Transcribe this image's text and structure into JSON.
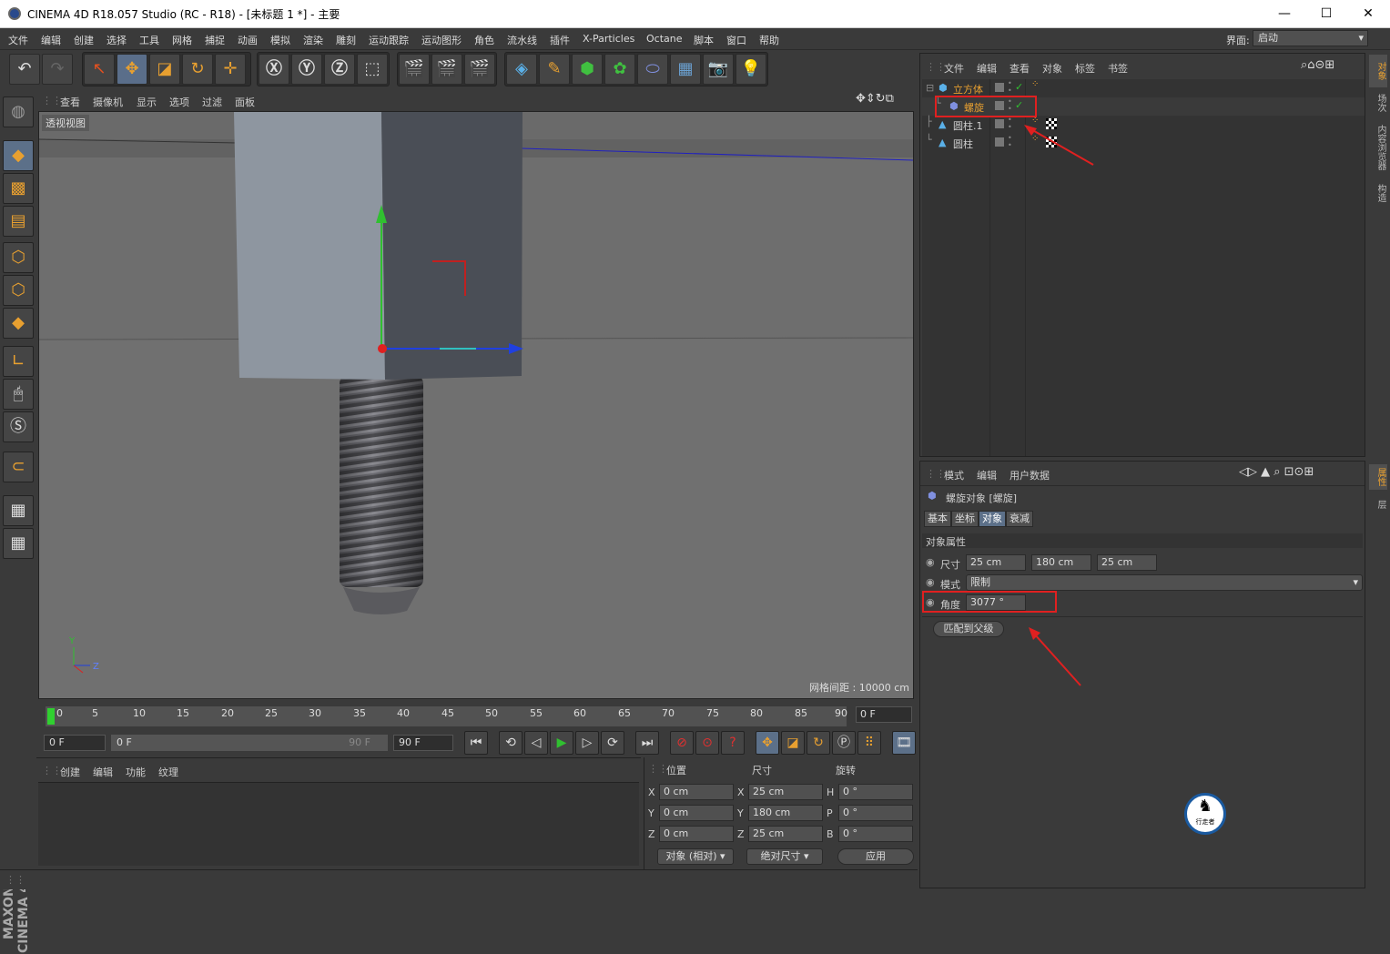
{
  "window": {
    "title": "CINEMA 4D R18.057 Studio (RC - R18) - [未标题 1 *] - 主要",
    "minimize": "—",
    "maximize": "☐",
    "close": "✕"
  },
  "menubar": {
    "items": [
      "文件",
      "编辑",
      "创建",
      "选择",
      "工具",
      "网格",
      "捕捉",
      "动画",
      "模拟",
      "渲染",
      "雕刻",
      "运动跟踪",
      "运动图形",
      "角色",
      "流水线",
      "插件",
      "X-Particles",
      "Octane",
      "脚本",
      "窗口",
      "帮助"
    ],
    "interface_label": "界面:",
    "interface_value": "启动"
  },
  "viewport": {
    "menu": [
      "查看",
      "摄像机",
      "显示",
      "选项",
      "过滤",
      "面板"
    ],
    "label": "透视视图",
    "grid_info": "网格间距 : 10000 cm",
    "axis_y": "Y",
    "axis_z": "Z"
  },
  "timeline": {
    "ticks": [
      "0",
      "5",
      "10",
      "15",
      "20",
      "25",
      "30",
      "35",
      "40",
      "45",
      "50",
      "55",
      "60",
      "65",
      "70",
      "75",
      "80",
      "85",
      "90"
    ],
    "current_frame": "0 F",
    "start": "0 F",
    "range_start": "0 F",
    "range_end": "90 F",
    "end": "90 F"
  },
  "material_manager": {
    "menu": [
      "创建",
      "编辑",
      "功能",
      "纹理"
    ]
  },
  "coordinates": {
    "headers": [
      "位置",
      "尺寸",
      "旋转"
    ],
    "rows": [
      {
        "axis": "X",
        "pos": "0 cm",
        "size_axis": "X",
        "size": "25 cm",
        "rot_axis": "H",
        "rot": "0 °"
      },
      {
        "axis": "Y",
        "pos": "0 cm",
        "size_axis": "Y",
        "size": "180 cm",
        "rot_axis": "P",
        "rot": "0 °"
      },
      {
        "axis": "Z",
        "pos": "0 cm",
        "size_axis": "Z",
        "size": "25 cm",
        "rot_axis": "B",
        "rot": "0 °"
      }
    ],
    "mode": "对象 (相对)",
    "size_mode": "绝对尺寸",
    "apply": "应用"
  },
  "object_manager": {
    "menu": [
      "文件",
      "编辑",
      "查看",
      "对象",
      "标签",
      "书签"
    ],
    "objects": [
      {
        "name": "立方体",
        "color": "#e8a030"
      },
      {
        "name": "螺旋",
        "color": "#e8a030"
      },
      {
        "name": "圆柱.1",
        "color": "#cfcfcf"
      },
      {
        "name": "圆柱",
        "color": "#cfcfcf"
      }
    ]
  },
  "attribute_manager": {
    "menu": [
      "模式",
      "编辑",
      "用户数据"
    ],
    "object_title": "螺旋对象 [螺旋]",
    "tabs": [
      "基本",
      "坐标",
      "对象",
      "衰减"
    ],
    "active_tab": "对象",
    "section": "对象属性",
    "size_label": "尺寸",
    "size_x": "25 cm",
    "size_y": "180 cm",
    "size_z": "25 cm",
    "mode_label": "模式",
    "mode_value": "限制",
    "angle_label": "角度",
    "angle_value": "3077 °",
    "fit_button": "匹配到父级"
  },
  "side_tabs": [
    "对象",
    "场次",
    "内容浏览器",
    "构造",
    "属性",
    "层"
  ],
  "brand": "MAXON CINEMA 4D",
  "watermark": "行走者",
  "colors": {
    "accent_orange": "#e8a030",
    "highlight_red": "#e02020",
    "active_tab": "#5c7089"
  }
}
